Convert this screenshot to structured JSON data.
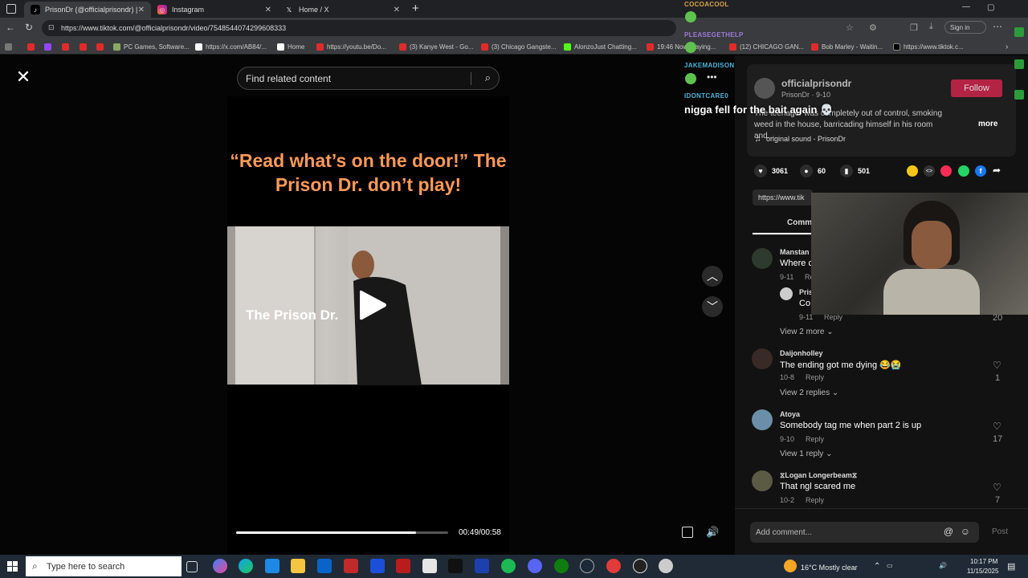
{
  "browser": {
    "tabs": [
      {
        "title": "PrisonDr (@officialprisondr) | TikT",
        "active": true
      },
      {
        "title": "Instagram",
        "active": false
      },
      {
        "title": "Home / X",
        "active": false
      }
    ],
    "url": "https://www.tiktok.com/@officialprisondr/video/7548544074299608333",
    "sign_in_label": "Sign in",
    "bookmarks": [
      "PC Games, Software...",
      "https://x.com/AB84/...",
      "Home",
      "https://youtu.be/Do...",
      "(3) Kanye West - Go...",
      "(3) Chicago Gangste...",
      "AlonzoJust Chatting...",
      "19:46 Now Playing...",
      "(12) CHICAGO GAN...",
      "Bob Marley - Waitin...",
      "https://www.tiktok.c..."
    ]
  },
  "viewer": {
    "search_placeholder": "Find related content",
    "video_title": "“Read what’s on the door!” The Prison Dr. don’t play!",
    "video_overlay_text": "The Prison Dr.",
    "progress": 0.847,
    "timecode": "00:49/00:58"
  },
  "post": {
    "username": "officialprisondr",
    "subline": "PrisonDr · 9-10",
    "follow_label": "Follow",
    "description": "The teenager was completely out of control, smoking weed in the house, barricading himself in his room and...",
    "more_label": "more",
    "sound": "original sound - PrisonDr",
    "likes": "3061",
    "comments": "60",
    "saves": "501",
    "link_prefix": "https://www.tik",
    "comments_tab": "Comm"
  },
  "comments": [
    {
      "name": "Manstan",
      "text": "Where c",
      "date": "9-11",
      "reply": "Repl",
      "likes": ""
    },
    {
      "name": "Pris",
      "text": "Co",
      "date": "9-11",
      "reply": "Reply",
      "likes": "20",
      "nested": true
    },
    {
      "view_more": "View 2 more"
    },
    {
      "name": "Daijonholley",
      "text": "The ending got me dying 😂😭",
      "date": "10-8",
      "reply": "Reply",
      "likes": "1",
      "view": "View 2 replies"
    },
    {
      "name": "Atoya",
      "text": "Somebody tag me when part 2 is up",
      "date": "9-10",
      "reply": "Reply",
      "likes": "17",
      "view": "View 1 reply"
    },
    {
      "name": "⧖Logan Longerbeam⧖",
      "text": "That ngl scared me",
      "date": "10-2",
      "reply": "Reply",
      "likes": "7"
    }
  ],
  "comment_input": {
    "placeholder": "Add comment...",
    "post_label": "Post"
  },
  "chat": [
    {
      "name": "COCOACOOL",
      "color": "#d9a24a"
    },
    {
      "name": "PLEASEGETHELP",
      "color": "#9b7bd8"
    },
    {
      "name": "JAKEMADISON",
      "color": "#4ab3d9"
    },
    {
      "name": "IDONTCARE0",
      "color": "#4ab3d9"
    }
  ],
  "chat_message": "nigga fell for the bait again 💀",
  "taskbar": {
    "search_placeholder": "Type here to search",
    "weather": "16°C  Mostly clear",
    "time": "10:17 PM",
    "date": "11/15/2025"
  },
  "colors": {
    "accent": "#fe2c55",
    "chat_green": "#5fc14f"
  }
}
